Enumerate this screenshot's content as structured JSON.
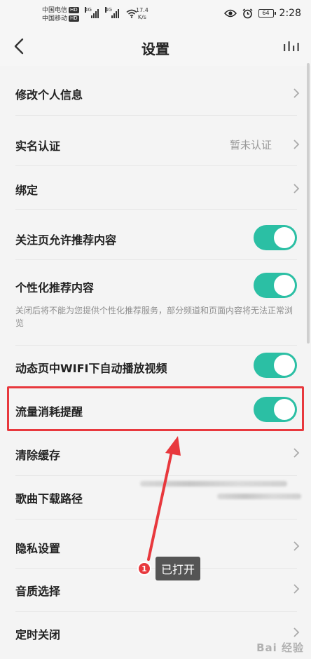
{
  "status_bar": {
    "carrier1": "中国电信",
    "carrier2": "中国移动",
    "hd": "HD",
    "signal_gen": "4G",
    "speed_value": "17.4",
    "speed_unit": "K/s",
    "battery": "64",
    "time": "2:28",
    "icons": [
      "eye-icon",
      "alarm-icon",
      "battery-icon",
      "wifi-icon",
      "signal-icon"
    ]
  },
  "header": {
    "title": "设置",
    "back_icon": "chevron-left-icon",
    "right_icon": "stats-icon"
  },
  "settings": {
    "edit_profile": "修改个人信息",
    "real_name": "实名认证",
    "real_name_value": "暂未认证",
    "bind": "绑定",
    "follow_recommend": "关注页允许推荐内容",
    "personalized": "个性化推荐内容",
    "personalized_note": "关闭后将不能为您提供个性化推荐服务，部分频道和页面内容将无法正常浏览",
    "wifi_autoplay": "动态页中WIFI下自动播放视频",
    "traffic_reminder": "流量消耗提醒",
    "clear_cache": "清除缓存",
    "download_path": "歌曲下载路径",
    "privacy": "隐私设置",
    "sound_quality": "音质选择",
    "timer_close": "定时关闭"
  },
  "toggles": {
    "follow_recommend": true,
    "personalized": true,
    "wifi_autoplay": true,
    "traffic_reminder": true
  },
  "annotation": {
    "badge": "1",
    "tip": "已打开",
    "highlight_color": "#e8383d"
  },
  "watermark": "Bai 经验",
  "colors": {
    "toggle_on": "#2bbfa4",
    "annotation_red": "#e8383d"
  }
}
